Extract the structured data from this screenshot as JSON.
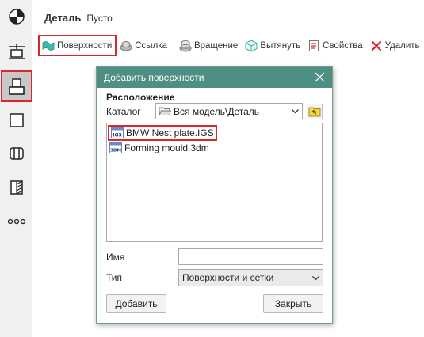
{
  "header": {
    "title": "Деталь",
    "subtitle": "Пусто"
  },
  "left_toolbar": {
    "items": [
      {
        "icon": "ball-icon"
      },
      {
        "icon": "extrude-icon"
      },
      {
        "icon": "surface-tool-icon",
        "active": true
      },
      {
        "icon": "square-icon"
      },
      {
        "icon": "shell-icon"
      },
      {
        "icon": "hatch-icon"
      },
      {
        "icon": "more-icon"
      }
    ]
  },
  "toolbar": {
    "surfaces": "Поверхности",
    "link": "Ссылка",
    "rotate": "Вращение",
    "extrude": "Вытянуть",
    "properties": "Свойства",
    "delete": "Удалить"
  },
  "dialog": {
    "title": "Добавить поверхности",
    "section": "Расположение",
    "catalog_label": "Каталог",
    "catalog_value": "Вся модель\\Деталь",
    "files": [
      {
        "name": "BMW Nest plate.IGS",
        "badge": "IGS",
        "selected": true
      },
      {
        "name": "Forming mould.3dm",
        "badge": "3DM",
        "selected": false
      }
    ],
    "name_label": "Имя",
    "name_value": "",
    "type_label": "Тип",
    "type_value": "Поверхности и сетки",
    "add_button": "Добавить",
    "close_button": "Закрыть"
  },
  "colors": {
    "accent": "#4e8f83",
    "highlight": "#d9272e"
  }
}
